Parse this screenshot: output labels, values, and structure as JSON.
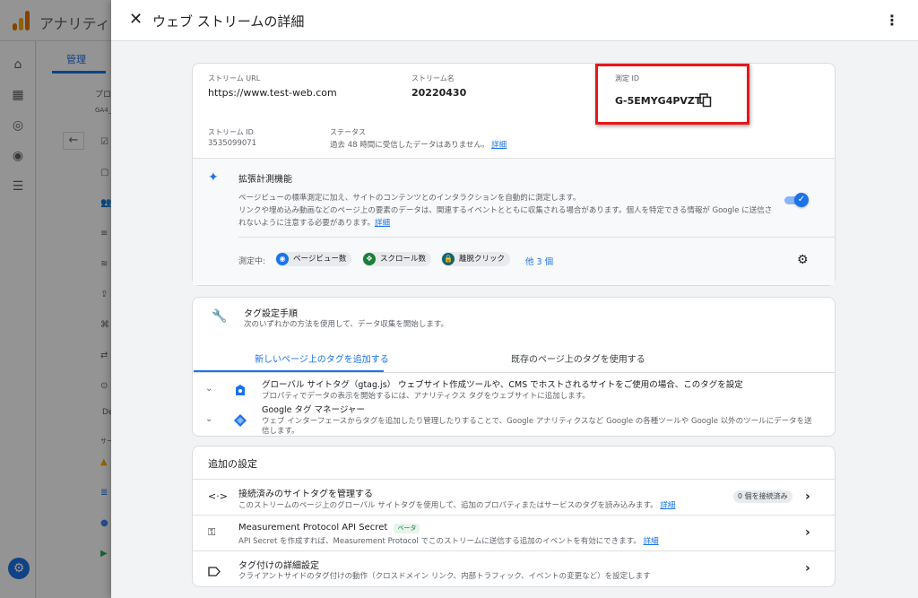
{
  "background": {
    "app_title": "アナリティ",
    "tab": "管理",
    "snippets": [
      "プロ",
      "GA4_",
      "サー",
      "De"
    ]
  },
  "dialog": {
    "title": "ウェブ ストリームの詳細",
    "stream": {
      "url_label": "ストリーム URL",
      "url_value": "https://www.test-web.com",
      "name_label": "ストリーム名",
      "name_value": "20220430",
      "measurement_id_label": "測定 ID",
      "measurement_id_value": "G-5EMYG4PVZT",
      "id_label": "ストリーム ID",
      "id_value": "3535099071",
      "status_label": "ステータス",
      "status_value": "過去 48 時間に受信したデータはありません。",
      "status_link": "詳細"
    },
    "enhanced": {
      "title": "拡張計測機能",
      "desc_line1": "ページビューの標準測定に加え、サイトのコンテンツとのインタラクションを自動的に測定します。",
      "desc_line2": "リンクや埋め込み動画などのページ上の要素のデータは、関連するイベントとともに収集される場合があります。個人を特定できる情報が Google に送信さ",
      "desc_line3": "れないように注意する必要があります。",
      "desc_link": "詳細",
      "measuring_label": "測定中:",
      "chips": [
        "ページビュー数",
        "スクロール数",
        "離脱クリック"
      ],
      "more": "他 3 個",
      "toggle_on": true
    },
    "tagging": {
      "title": "タグ設定手順",
      "subtitle": "次のいずれかの方法を使用して、データ収集を開始します。",
      "tab_new": "新しいページ上のタグを追加する",
      "tab_existing": "既存のページ上のタグを使用する",
      "options": [
        {
          "title": "グローバル サイトタグ（gtag.js） ウェブサイト作成ツールや、CMS でホストされるサイトをご使用の場合、このタグを設定",
          "desc": "プロパティでデータの表示を開始するには、アナリティクス タグをウェブサイトに追加します。"
        },
        {
          "title": "Google タグ マネージャー",
          "desc_line1": "ウェブ インターフェースからタグを追加したり管理したりすることで、Google アナリティクスなど Google の各種ツールや Google 以外のツールにデータを送",
          "desc_line2": "信します。"
        }
      ]
    },
    "additional": {
      "title": "追加の設定",
      "rows": [
        {
          "title": "接続済みのサイトタグを管理する",
          "desc": "このストリームのページ上のグローバル サイトタグを使用して、追加のプロパティまたはサービスのタグを読み込みます。",
          "link": "詳細",
          "badge": "0 個を接続済み"
        },
        {
          "title": "Measurement Protocol API Secret",
          "beta": "ベータ",
          "desc": "API Secret を作成すれば、Measurement Protocol でこのストリームに送信する追加のイベントを有効にできます。",
          "link": "詳細"
        },
        {
          "title": "タグ付けの詳細設定",
          "desc": "クライアントサイドのタグ付けの動作（クロスドメイン リンク、内部トラフィック、イベントの変更など）を設定します"
        }
      ]
    }
  },
  "colors": {
    "accent": "#1a73e8",
    "highlight_border": "#e8161a",
    "chip_pageview": "#1a73e8",
    "chip_scroll": "#188038",
    "chip_outbound": "#12646e"
  },
  "icons": [
    "close-icon",
    "more-vert-icon",
    "copy-icon",
    "sparkle-icon",
    "eye-icon",
    "scroll-icon",
    "lock-icon",
    "settings-gear-icon",
    "wrench-icon",
    "chevron-down-icon",
    "tag-icon",
    "gtm-diamond-icon",
    "code-icon",
    "key-icon",
    "label-icon",
    "chevron-right-icon"
  ]
}
